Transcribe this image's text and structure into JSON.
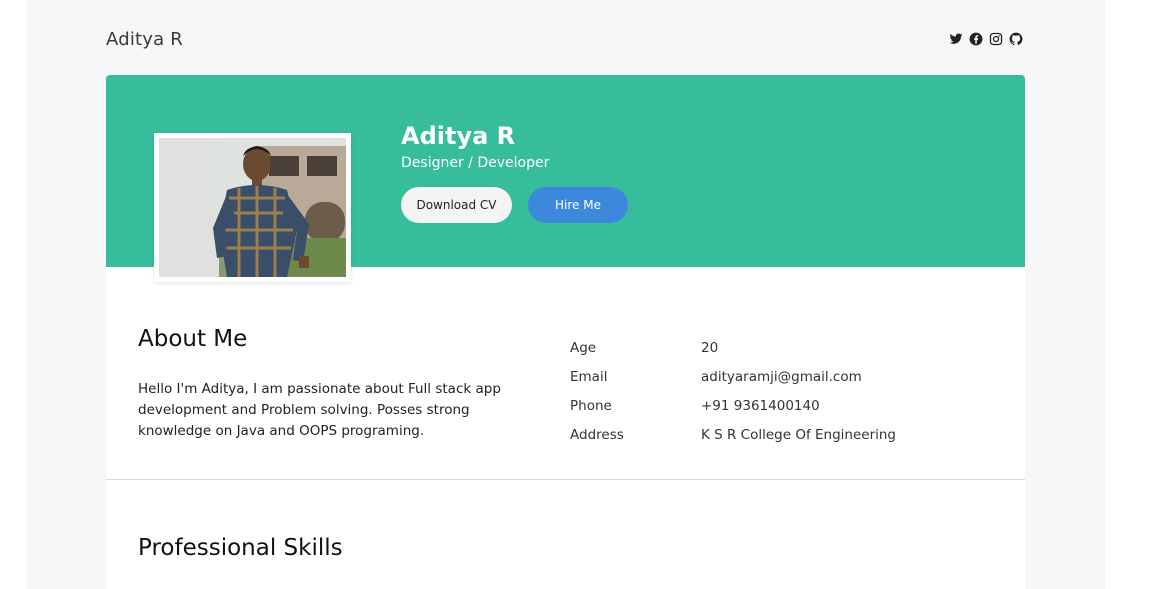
{
  "header": {
    "brand": "Aditya R",
    "socials": [
      {
        "icon": "twitter-icon"
      },
      {
        "icon": "facebook-icon"
      },
      {
        "icon": "instagram-icon"
      },
      {
        "icon": "github-icon"
      }
    ]
  },
  "hero": {
    "name": "Aditya R",
    "role": "Designer / Developer",
    "download_cv_label": "Download CV",
    "hire_me_label": "Hire Me"
  },
  "about": {
    "title": "About Me",
    "text": "Hello I'm Aditya, I am passionate about Full stack app development and Problem solving. Posses strong knowledge on Java and OOPS programing."
  },
  "info": [
    {
      "key": "Age",
      "value": "20"
    },
    {
      "key": "Email",
      "value": "adityaramji@gmail.com"
    },
    {
      "key": "Phone",
      "value": "+91 9361400140"
    },
    {
      "key": "Address",
      "value": "K S R College Of Engineering"
    }
  ],
  "skills": {
    "title": "Professional Skills"
  },
  "colors": {
    "hero_bg": "#37bd9b",
    "hire_button": "#3b88dc",
    "page_bg": "#f7f7f9"
  }
}
